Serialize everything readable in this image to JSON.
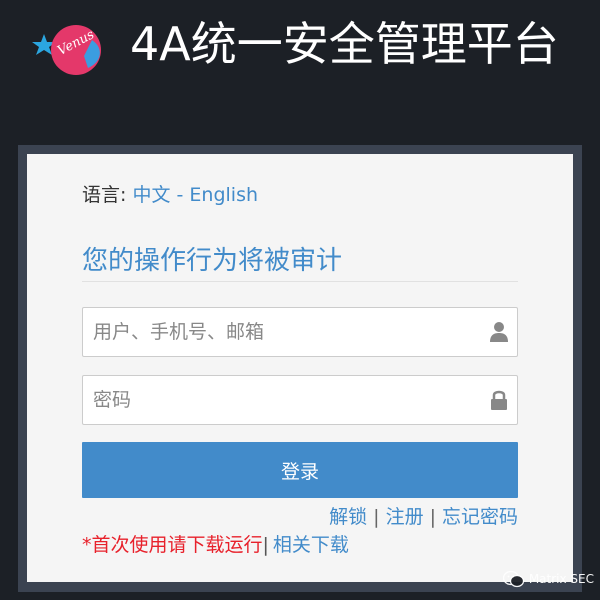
{
  "header": {
    "title": "4A统一安全管理平台",
    "logo_text": "Venus"
  },
  "language": {
    "label": "语言:",
    "options": [
      "中文",
      "English"
    ],
    "separator": "-"
  },
  "form": {
    "audit_notice": "您的操作行为将被审计",
    "username": {
      "placeholder": "用户、手机号、邮箱",
      "value": "",
      "icon": "user-icon"
    },
    "password": {
      "placeholder": "密码",
      "value": "",
      "icon": "lock-icon"
    },
    "login_label": "登录"
  },
  "links": {
    "unlock": "解锁",
    "register": "注册",
    "forgot": "忘记密码",
    "pipe": "|"
  },
  "first_use": {
    "notice": "*首次使用请下载运行",
    "download": "相关下载"
  },
  "watermark": "Matrix SEC",
  "colors": {
    "background": "#1c2026",
    "panel": "#f5f5f5",
    "accent": "#428bca",
    "warning": "#e8212b"
  }
}
